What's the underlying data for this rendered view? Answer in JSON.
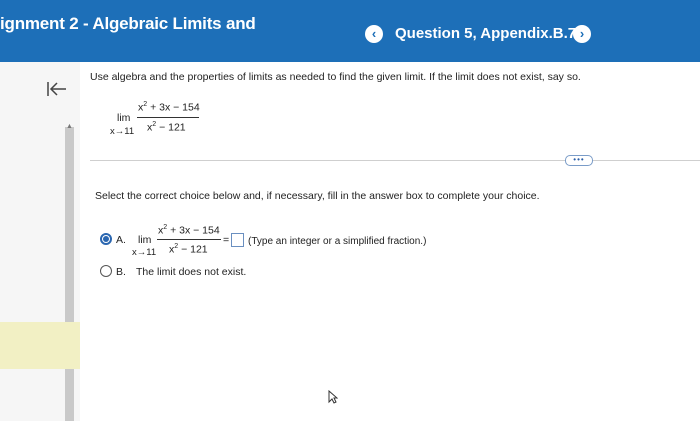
{
  "header": {
    "title": "ignment 2 - Algebraic Limits and",
    "question_label": "Question 5, Appendix.B.7",
    "prev_glyph": "‹",
    "next_glyph": "›"
  },
  "problem": {
    "instructions": "Use algebra and the properties of limits as needed to find the given limit. If the limit does not exist, say so.",
    "lim": "lim",
    "lim_sub": "x→11",
    "numerator_base": "x",
    "numerator_exp": "2",
    "numerator_rest": " + 3x − 154",
    "denominator_base": "x",
    "denominator_exp": "2",
    "denominator_rest": " − 121"
  },
  "more_button": "•••",
  "select_text": "Select the correct choice below and, if necessary, fill in the answer box to complete your choice.",
  "choice_a": {
    "letter": "A.",
    "lim": "lim",
    "lim_sub": "x→11",
    "numerator_base": "x",
    "numerator_exp": "2",
    "numerator_rest": " + 3x − 154",
    "denominator_base": "x",
    "denominator_exp": "2",
    "denominator_rest": " − 121",
    "equals": "=",
    "hint": "(Type an integer or a simplified fraction.)",
    "selected": true
  },
  "choice_b": {
    "letter": "B.",
    "text": "The limit does not exist.",
    "selected": false
  },
  "colors": {
    "header_bg": "#1d6fb8",
    "accent": "#2a66b0",
    "sidebar_highlight": "#f2f0c4"
  }
}
